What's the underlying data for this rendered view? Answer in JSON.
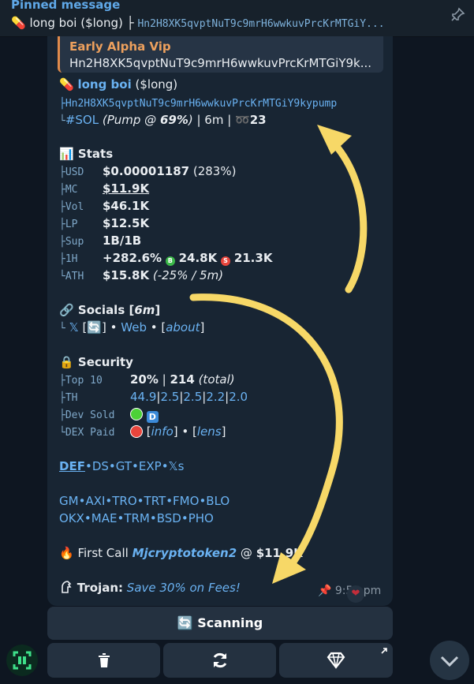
{
  "pinned": {
    "title": "Pinned message",
    "token_label": "long boi ($long)",
    "sep": " ├",
    "address": "Hn2H8XK5qvptNuT9c9mrH6wwkuvPrcKrMTGiY..."
  },
  "quote": {
    "title": "Early Alpha Vip",
    "text": "Hn2H8XK5qvptNuT9c9mrH6wwkuvPrcKrMTGiY9k..."
  },
  "header": {
    "name": "long boi",
    "ticker": "($long)",
    "address": "├Hn2H8XK5qvptNuT9c9mrH6wwkuvPrcKrMTGiY9kypump",
    "chain_prefix": "└",
    "chain": "#SOL",
    "pump": "(Pump @ ",
    "pump_pct": "69%",
    "pump_close": ")",
    "age": " | 6m | ",
    "count": "23"
  },
  "stats": {
    "title": "Stats",
    "rows": [
      {
        "key": "├USD",
        "value": "$0.00001187",
        "extra": " (283%)"
      },
      {
        "key": "├MC",
        "value": "$11.9K"
      },
      {
        "key": "├Vol",
        "value": "$46.1K"
      },
      {
        "key": "├LP",
        "value": "$12.5K"
      },
      {
        "key": "├Sup",
        "value": "1B/1B"
      },
      {
        "key": "├1H",
        "value": "+282.6%",
        "buys": "24.8K",
        "sells": "21.3K"
      },
      {
        "key": "└ATH",
        "value": "$15.8K",
        "extra": " (-25% / 5m)"
      }
    ]
  },
  "socials": {
    "title": "Socials [",
    "age": "6m",
    "close": "]",
    "prefix": "└",
    "x": "𝕏",
    "web": "Web",
    "about": "about",
    "bullet": " • "
  },
  "security": {
    "title": "Security",
    "top10_key": "├Top 10",
    "top10_pct": "20%",
    "top10_sep": " | ",
    "top10_total": "214",
    "top10_total_label": " (total)",
    "th_key": "├TH",
    "th_values": [
      "44.9",
      "2.5",
      "2.5",
      "2.2",
      "2.0"
    ],
    "dev_key": "├Dev Sold",
    "dev_badge": "D",
    "dex_key": "└DEX Paid",
    "info": "info",
    "lens": "lens"
  },
  "links_row1": [
    "DEF",
    "DS",
    "GT",
    "EXP",
    "𝕏s"
  ],
  "links_row2": [
    "GM",
    "AXI",
    "TRO",
    "TRT",
    "FMO",
    "BLO"
  ],
  "links_row3": [
    "OKX",
    "MAE",
    "TRM",
    "BSD",
    "PHO"
  ],
  "first_call": {
    "prefix": "First Call ",
    "user": "Mjcryptotoken2",
    "at": " @ ",
    "mc": "$11.9K"
  },
  "trojan": {
    "label": "Trojan:",
    "promo": "Save 30% on Fees!"
  },
  "meta": {
    "time": "9:55 pm"
  },
  "buttons": {
    "scanning": "Scanning"
  },
  "colors": {
    "bubble": "#182533",
    "link": "#6ab2f2",
    "annotation_arrow": "#f7d867",
    "buy": "#3cb94a",
    "sell": "#e8453c"
  }
}
